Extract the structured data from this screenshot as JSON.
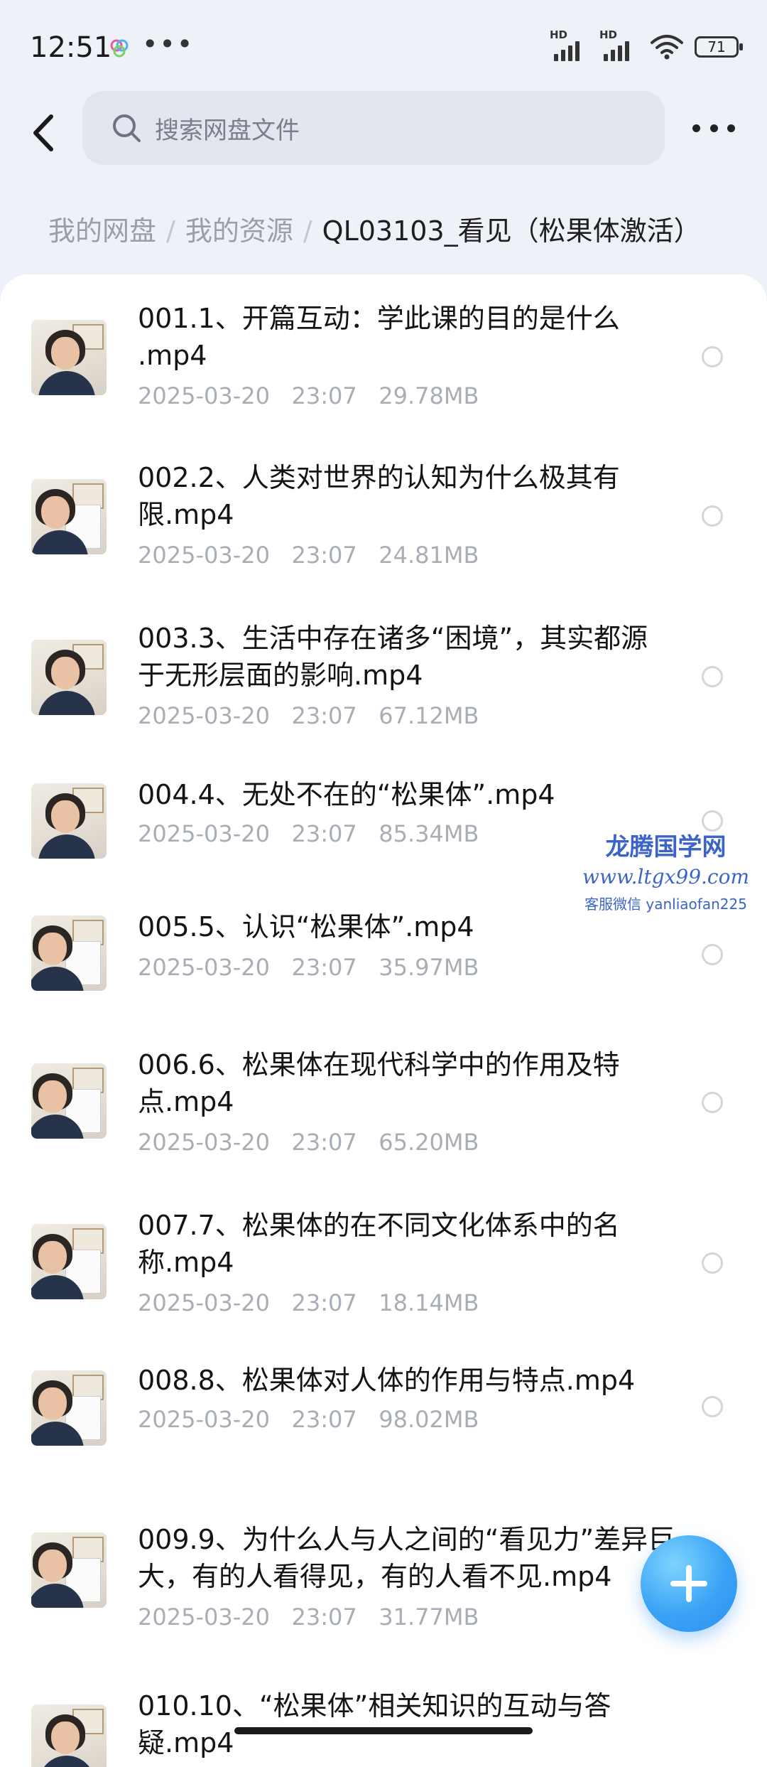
{
  "status": {
    "time": "12:51",
    "dots": "•••",
    "hd1": "HD",
    "hd2": "HD",
    "battery": "71"
  },
  "search": {
    "placeholder": "搜索网盘文件"
  },
  "breadcrumb": {
    "root": "我的网盘",
    "sep": "/",
    "mid": "我的资源",
    "current": "QL03103_看见（松果体激活）"
  },
  "files": [
    {
      "title": "001.1、开篇互动：学此课的目的是什么 .mp4",
      "date": "2025-03-20",
      "time": "23:07",
      "size": "29.78MB"
    },
    {
      "title": "002.2、人类对世界的认知为什么极其有限.mp4",
      "date": "2025-03-20",
      "time": "23:07",
      "size": "24.81MB"
    },
    {
      "title": "003.3、生活中存在诸多“困境”，其实都源于无形层面的影响.mp4",
      "date": "2025-03-20",
      "time": "23:07",
      "size": "67.12MB"
    },
    {
      "title": "004.4、无处不在的“松果体”.mp4",
      "date": "2025-03-20",
      "time": "23:07",
      "size": "85.34MB"
    },
    {
      "title": "005.5、认识“松果体”.mp4",
      "date": "2025-03-20",
      "time": "23:07",
      "size": "35.97MB"
    },
    {
      "title": "006.6、松果体在现代科学中的作用及特点.mp4",
      "date": "2025-03-20",
      "time": "23:07",
      "size": "65.20MB"
    },
    {
      "title": "007.7、松果体的在不同文化体系中的名称.mp4",
      "date": "2025-03-20",
      "time": "23:07",
      "size": "18.14MB"
    },
    {
      "title": "008.8、松果体对人体的作用与特点.mp4",
      "date": "2025-03-20",
      "time": "23:07",
      "size": "98.02MB"
    },
    {
      "title": "009.9、为什么人与人之间的“看见力”差异巨大，有的人看得见，有的人看不见.mp4",
      "date": "2025-03-20",
      "time": "23:07",
      "size": "31.77MB"
    },
    {
      "title": "010.10、“松果体”相关知识的互动与答疑.mp4",
      "date": "",
      "time": "",
      "size": ""
    }
  ],
  "watermark": {
    "line1": "龙腾国学网",
    "line2": "www.ltgx99.com",
    "line3": "客服微信 yanliaofan225"
  },
  "colors": {
    "accent": "#3aa3f5",
    "watermark": "#3c64c8"
  },
  "icons": {
    "back": "chevron-left-icon",
    "search": "search-icon",
    "more": "more-icon",
    "add": "plus-icon"
  }
}
